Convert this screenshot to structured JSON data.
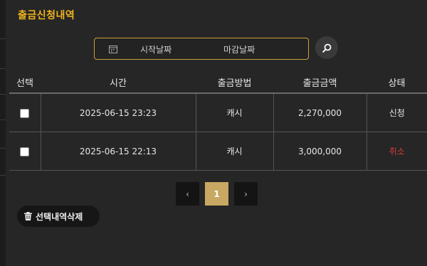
{
  "title": "출금신청내역",
  "filter": {
    "start_placeholder": "시작날짜",
    "end_placeholder": "마감날짜"
  },
  "table": {
    "headers": [
      "선택",
      "시간",
      "출금방법",
      "출금금액",
      "상태"
    ],
    "rows": [
      {
        "time": "2025-06-15 23:23",
        "method": "캐시",
        "amount": "2,270,000",
        "status": "신청",
        "status_color": "#e6e6e6"
      },
      {
        "time": "2025-06-15 22:13",
        "method": "캐시",
        "amount": "3,000,000",
        "status": "취소",
        "status_color": "#d23c3c"
      }
    ]
  },
  "pagination": {
    "prev": "‹",
    "current": "1",
    "next": "›"
  },
  "delete_button": {
    "label": "선택내역삭제",
    "icon": "trash-icon"
  },
  "colors": {
    "accent": "#f0b41c",
    "page_active": "#c8a862",
    "cancel": "#d23c3c"
  }
}
